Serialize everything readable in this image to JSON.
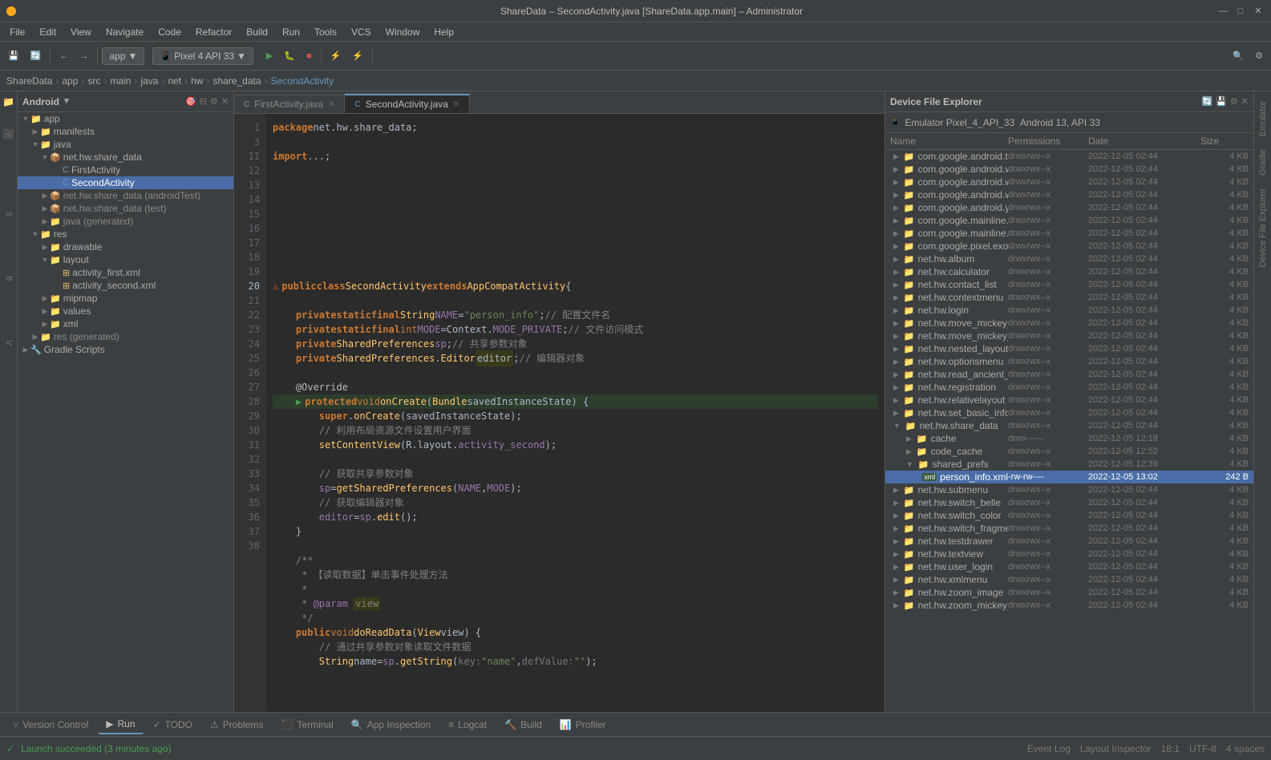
{
  "titleBar": {
    "title": "ShareData – SecondActivity.java [ShareData.app.main] – Administrator",
    "minimize": "—",
    "maximize": "□",
    "close": "✕"
  },
  "menuBar": {
    "items": [
      "File",
      "Edit",
      "View",
      "Navigate",
      "Code",
      "Refactor",
      "Build",
      "Run",
      "Tools",
      "VCS",
      "Window",
      "Help"
    ]
  },
  "toolbar": {
    "appBtn": "app",
    "deviceBtn": "Pixel 4 API 33",
    "searchIcon": "🔍"
  },
  "breadcrumb": {
    "items": [
      "ShareData",
      "app",
      "src",
      "main",
      "java",
      "net",
      "hw",
      "share_data",
      "SecondActivity"
    ]
  },
  "project": {
    "title": "Android",
    "dropdown": "▼",
    "tree": [
      {
        "id": "app",
        "label": "app",
        "level": 0,
        "type": "folder",
        "expanded": true
      },
      {
        "id": "manifests",
        "label": "manifests",
        "level": 1,
        "type": "folder",
        "expanded": false
      },
      {
        "id": "java",
        "label": "java",
        "level": 1,
        "type": "folder",
        "expanded": true
      },
      {
        "id": "net.hw.share_data",
        "label": "net.hw.share_data",
        "level": 2,
        "type": "package",
        "expanded": true
      },
      {
        "id": "FirstActivity",
        "label": "FirstActivity",
        "level": 3,
        "type": "java"
      },
      {
        "id": "SecondActivity",
        "label": "SecondActivity",
        "level": 3,
        "type": "java",
        "selected": true
      },
      {
        "id": "net.hw.share_data.androidTest",
        "label": "net.hw.share_data (androidTest)",
        "level": 2,
        "type": "package",
        "expanded": false
      },
      {
        "id": "net.hw.share_data.test",
        "label": "net.hw.share_data (test)",
        "level": 2,
        "type": "package",
        "expanded": false
      },
      {
        "id": "java.generated",
        "label": "java (generated)",
        "level": 2,
        "type": "package",
        "expanded": false
      },
      {
        "id": "res",
        "label": "res",
        "level": 1,
        "type": "folder",
        "expanded": true
      },
      {
        "id": "drawable",
        "label": "drawable",
        "level": 2,
        "type": "folder",
        "expanded": false
      },
      {
        "id": "layout",
        "label": "layout",
        "level": 2,
        "type": "folder",
        "expanded": true
      },
      {
        "id": "activity_first.xml",
        "label": "activity_first.xml",
        "level": 3,
        "type": "xml"
      },
      {
        "id": "activity_second.xml",
        "label": "activity_second.xml",
        "level": 3,
        "type": "xml"
      },
      {
        "id": "mipmap",
        "label": "mipmap",
        "level": 2,
        "type": "folder",
        "expanded": false
      },
      {
        "id": "values",
        "label": "values",
        "level": 2,
        "type": "folder",
        "expanded": false
      },
      {
        "id": "xml",
        "label": "xml",
        "level": 2,
        "type": "folder",
        "expanded": false
      },
      {
        "id": "res.generated",
        "label": "res (generated)",
        "level": 1,
        "type": "folder",
        "expanded": false
      },
      {
        "id": "Gradle Scripts",
        "label": "Gradle Scripts",
        "level": 0,
        "type": "gradle",
        "expanded": false
      }
    ]
  },
  "editorTabs": [
    {
      "label": "FirstActivity.java",
      "active": false,
      "modified": false
    },
    {
      "label": "SecondActivity.java",
      "active": true,
      "modified": false
    }
  ],
  "codeLines": [
    {
      "num": 1,
      "text": "package net.hw.share_data;",
      "mark": ""
    },
    {
      "num": 3,
      "text": "import ...;",
      "mark": ""
    },
    {
      "num": 11,
      "text": "",
      "mark": ""
    },
    {
      "num": 12,
      "text": "public class SecondActivity extends AppCompatActivity {",
      "mark": "error"
    },
    {
      "num": 13,
      "text": "",
      "mark": ""
    },
    {
      "num": 14,
      "text": "    private static final String NAME = \"person_info\"; // 配置文件名",
      "mark": ""
    },
    {
      "num": 15,
      "text": "    private static final int MODE = Context.MODE_PRIVATE; // 文件访问模式",
      "mark": ""
    },
    {
      "num": 16,
      "text": "    private SharedPreferences sp; // 共享参数对象",
      "mark": ""
    },
    {
      "num": 17,
      "text": "    private SharedPreferences.Editor editor; // 编辑器对象",
      "mark": ""
    },
    {
      "num": 18,
      "text": "",
      "mark": ""
    },
    {
      "num": 19,
      "text": "    @Override",
      "mark": ""
    },
    {
      "num": 20,
      "text": "    protected void onCreate(Bundle savedInstanceState) {",
      "mark": "run"
    },
    {
      "num": 21,
      "text": "        super.onCreate(savedInstanceState);",
      "mark": ""
    },
    {
      "num": 22,
      "text": "        // 利用布局资源文件设置用户界面",
      "mark": ""
    },
    {
      "num": 23,
      "text": "        setContentView(R.layout.activity_second);",
      "mark": ""
    },
    {
      "num": 24,
      "text": "",
      "mark": ""
    },
    {
      "num": 25,
      "text": "        // 获取共享参数对象",
      "mark": ""
    },
    {
      "num": 26,
      "text": "        sp = getSharedPreferences(NAME, MODE);",
      "mark": ""
    },
    {
      "num": 27,
      "text": "        // 获取编辑器对象",
      "mark": ""
    },
    {
      "num": 28,
      "text": "        editor = sp.edit();",
      "mark": ""
    },
    {
      "num": 29,
      "text": "    }",
      "mark": ""
    },
    {
      "num": 30,
      "text": "",
      "mark": ""
    },
    {
      "num": 31,
      "text": "    /**",
      "mark": ""
    },
    {
      "num": 32,
      "text": "     * 【读取数据】单击事件处理方法",
      "mark": ""
    },
    {
      "num": 33,
      "text": "     *",
      "mark": ""
    },
    {
      "num": 34,
      "text": "     * @param view",
      "mark": ""
    },
    {
      "num": 35,
      "text": "     */",
      "mark": ""
    },
    {
      "num": 36,
      "text": "    public void doReadData(View view) {",
      "mark": ""
    },
    {
      "num": 37,
      "text": "        // 通过共享参数对象读取文件数据",
      "mark": ""
    },
    {
      "num": 38,
      "text": "        String name = sp.getString(key: \"name\", defValue: \"\");",
      "mark": ""
    }
  ],
  "dfe": {
    "title": "Device File Explorer",
    "device": "Emulator Pixel_4_API_33  Android 13, API 33",
    "columns": [
      "Name",
      "Permissions",
      "Date",
      "Size"
    ],
    "rows": [
      {
        "name": "com.google.android.tts",
        "type": "folder",
        "perms": "drwxrwx--x",
        "date": "2022-12-05 02:44",
        "size": "4 KB",
        "level": 0
      },
      {
        "name": "com.google.android.webview",
        "type": "folder",
        "perms": "drwxrwx--x",
        "date": "2022-12-05 02:44",
        "size": "4 KB",
        "level": 0
      },
      {
        "name": "com.google.android.wifi.dialog",
        "type": "folder",
        "perms": "drwxrwx--x",
        "date": "2022-12-05 02:44",
        "size": "4 KB",
        "level": 0
      },
      {
        "name": "com.google.android.wifi.resou",
        "type": "folder",
        "perms": "drwxrwx--x",
        "date": "2022-12-05 02:44",
        "size": "4 KB",
        "level": 0
      },
      {
        "name": "com.google.android.youtube",
        "type": "folder",
        "perms": "drwxrwx--x",
        "date": "2022-12-05 02:44",
        "size": "4 KB",
        "level": 0
      },
      {
        "name": "com.google.mainline.adservice",
        "type": "folder",
        "perms": "drwxrwx--x",
        "date": "2022-12-05 02:44",
        "size": "4 KB",
        "level": 0
      },
      {
        "name": "com.google.mainline.telemetry",
        "type": "folder",
        "perms": "drwxrwx--x",
        "date": "2022-12-05 02:44",
        "size": "4 KB",
        "level": 0
      },
      {
        "name": "com.google.pixel.exo",
        "type": "folder",
        "perms": "drwxrwx--x",
        "date": "2022-12-05 02:44",
        "size": "4 KB",
        "level": 0
      },
      {
        "name": "net.hw.album",
        "type": "folder",
        "perms": "drwxrwx--x",
        "date": "2022-12-05 02:44",
        "size": "4 KB",
        "level": 0
      },
      {
        "name": "net.hw.calculator",
        "type": "folder",
        "perms": "drwxrwx--x",
        "date": "2022-12-05 02:44",
        "size": "4 KB",
        "level": 0
      },
      {
        "name": "net.hw.contact_list",
        "type": "folder",
        "perms": "drwxrwx--x",
        "date": "2022-12-05 02:44",
        "size": "4 KB",
        "level": 0
      },
      {
        "name": "net.hw.contextmenu",
        "type": "folder",
        "perms": "drwxrwx--x",
        "date": "2022-12-05 02:44",
        "size": "4 KB",
        "level": 0
      },
      {
        "name": "net.hw.login",
        "type": "folder",
        "perms": "drwxrwx--x",
        "date": "2022-12-05 02:44",
        "size": "4 KB",
        "level": 0
      },
      {
        "name": "net.hw.move_mickey_by_key",
        "type": "folder",
        "perms": "drwxrwx--x",
        "date": "2022-12-05 02:44",
        "size": "4 KB",
        "level": 0
      },
      {
        "name": "net.hw.move_mickey_by_touch",
        "type": "folder",
        "perms": "drwxrwx--x",
        "date": "2022-12-05 02:44",
        "size": "4 KB",
        "level": 0
      },
      {
        "name": "net.hw.nested_layout",
        "type": "folder",
        "perms": "drwxrwx--x",
        "date": "2022-12-05 02:44",
        "size": "4 KB",
        "level": 0
      },
      {
        "name": "net.hw.optionsmenu",
        "type": "folder",
        "perms": "drwxrwx--x",
        "date": "2022-12-05 02:44",
        "size": "4 KB",
        "level": 0
      },
      {
        "name": "net.hw.read_ancient_poetry",
        "type": "folder",
        "perms": "drwxrwx--x",
        "date": "2022-12-05 02:44",
        "size": "4 KB",
        "level": 0
      },
      {
        "name": "net.hw.registration",
        "type": "folder",
        "perms": "drwxrwx--x",
        "date": "2022-12-05 02:44",
        "size": "4 KB",
        "level": 0
      },
      {
        "name": "net.hw.relativelayout",
        "type": "folder",
        "perms": "drwxrwx--x",
        "date": "2022-12-05 02:44",
        "size": "4 KB",
        "level": 0
      },
      {
        "name": "net.hw.set_basic_information",
        "type": "folder",
        "perms": "drwxrwx--x",
        "date": "2022-12-05 02:44",
        "size": "4 KB",
        "level": 0
      },
      {
        "name": "net.hw.share_data",
        "type": "folder",
        "perms": "drwxrwx--x",
        "date": "2022-12-05 02:44",
        "size": "4 KB",
        "level": 0,
        "expanded": true
      },
      {
        "name": "cache",
        "type": "folder",
        "perms": "drwx------",
        "date": "2022-12-05 12:18",
        "size": "4 KB",
        "level": 1
      },
      {
        "name": "code_cache",
        "type": "folder",
        "perms": "drwxrws--x",
        "date": "2022-12-05 12:52",
        "size": "4 KB",
        "level": 1
      },
      {
        "name": "shared_prefs",
        "type": "folder",
        "perms": "drwxrwx--x",
        "date": "2022-12-05 12:39",
        "size": "4 KB",
        "level": 1,
        "expanded": true
      },
      {
        "name": "person_info.xml",
        "type": "xml",
        "perms": "-rw-rw----",
        "date": "2022-12-05 13:02",
        "size": "242 B",
        "level": 2,
        "selected": true
      },
      {
        "name": "net.hw.submenu",
        "type": "folder",
        "perms": "drwxrwx--x",
        "date": "2022-12-05 02:44",
        "size": "4 KB",
        "level": 0
      },
      {
        "name": "net.hw.switch_belle",
        "type": "folder",
        "perms": "drwxrwx--x",
        "date": "2022-12-05 02:44",
        "size": "4 KB",
        "level": 0
      },
      {
        "name": "net.hw.switch_color",
        "type": "folder",
        "perms": "drwxrwx--x",
        "date": "2022-12-05 02:44",
        "size": "4 KB",
        "level": 0
      },
      {
        "name": "net.hw.switch_fragment",
        "type": "folder",
        "perms": "drwxrwx--x",
        "date": "2022-12-05 02:44",
        "size": "4 KB",
        "level": 0
      },
      {
        "name": "net.hw.testdrawer",
        "type": "folder",
        "perms": "drwxrwx--x",
        "date": "2022-12-05 02:44",
        "size": "4 KB",
        "level": 0
      },
      {
        "name": "net.hw.textview",
        "type": "folder",
        "perms": "drwxrwx--x",
        "date": "2022-12-05 02:44",
        "size": "4 KB",
        "level": 0
      },
      {
        "name": "net.hw.user_login",
        "type": "folder",
        "perms": "drwxrwx--x",
        "date": "2022-12-05 02:44",
        "size": "4 KB",
        "level": 0
      },
      {
        "name": "net.hw.xmlmenu",
        "type": "folder",
        "perms": "drwxrwx--x",
        "date": "2022-12-05 02:44",
        "size": "4 KB",
        "level": 0
      },
      {
        "name": "net.hw.zoom_image",
        "type": "folder",
        "perms": "drwxrwx--x",
        "date": "2022-12-05 02:44",
        "size": "4 KB",
        "level": 0
      },
      {
        "name": "net.hw.zoom_mickey_by_touch",
        "type": "folder",
        "perms": "drwxrwx--x",
        "date": "2022-12-05 02:44",
        "size": "4 KB",
        "level": 0
      }
    ]
  },
  "bottomTabs": [
    {
      "label": "Version Control",
      "icon": "⑂"
    },
    {
      "label": "Run",
      "icon": "▶"
    },
    {
      "label": "TODO",
      "icon": "✓"
    },
    {
      "label": "Problems",
      "icon": "⚠"
    },
    {
      "label": "Terminal",
      "icon": "⬛"
    },
    {
      "label": "App Inspection",
      "icon": "🔍"
    },
    {
      "label": "Logcat",
      "icon": "≡"
    },
    {
      "label": "Build",
      "icon": "🔨"
    },
    {
      "label": "Profiler",
      "icon": "📊"
    }
  ],
  "statusBar": {
    "message": "Launch succeeded (3 minutes ago)",
    "eventLog": "Event Log",
    "layoutInspector": "Layout Inspector",
    "lineCol": "18:1",
    "encoding": "UTF-8",
    "indent": "4 spaces"
  }
}
